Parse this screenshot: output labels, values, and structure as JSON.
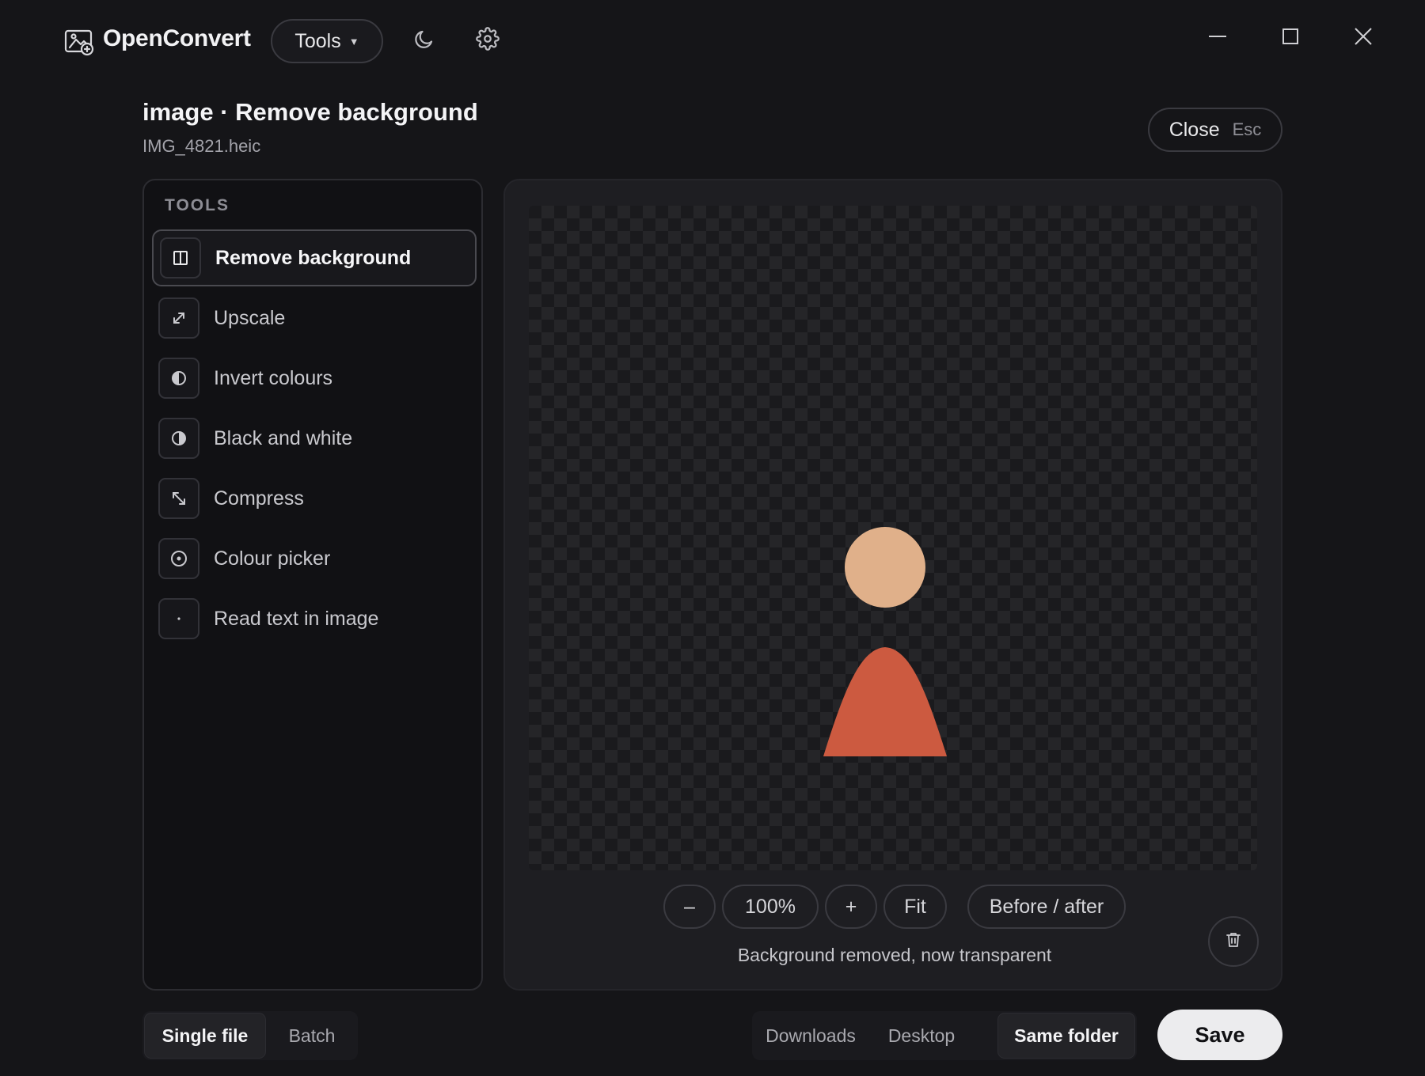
{
  "app": {
    "title": "OpenConvert",
    "logo_icon": "image-converter-logo-icon"
  },
  "header": {
    "tools_dropdown_label": "Tools",
    "theme_icon": "moon-icon",
    "settings_icon": "gear-icon",
    "window_controls": [
      "minimize-icon",
      "maximize-icon",
      "close-icon"
    ]
  },
  "page": {
    "title": "image · Remove background",
    "file_name": "IMG_4821.heic",
    "close_label": "Close",
    "close_shortcut": "Esc"
  },
  "tools_panel": {
    "heading": "TOOLS",
    "items": [
      {
        "label": "Remove background",
        "icon": "split-square-icon",
        "active": true
      },
      {
        "label": "Upscale",
        "icon": "expand-arrows-icon",
        "active": false
      },
      {
        "label": "Invert colours",
        "icon": "half-circle-icon",
        "active": false
      },
      {
        "label": "Black and white",
        "icon": "contrast-icon",
        "active": false
      },
      {
        "label": "Compress",
        "icon": "compress-arrows-icon",
        "active": false
      },
      {
        "label": "Colour picker",
        "icon": "target-icon",
        "active": false
      },
      {
        "label": "Read text in image",
        "icon": "dot-icon",
        "active": false
      }
    ]
  },
  "preview": {
    "subject_colors": {
      "head": "#e0b08a",
      "body": "#cc5a40"
    },
    "zoom_out_label": "–",
    "zoom_level": "100%",
    "zoom_in_label": "+",
    "fit_label": "Fit",
    "before_after_label": "Before / after",
    "status": "Background removed, now transparent",
    "delete_icon": "trash-icon"
  },
  "footer": {
    "mode_options": [
      {
        "label": "Single file",
        "selected": true
      },
      {
        "label": "Batch",
        "selected": false
      }
    ],
    "destination_options": [
      {
        "label": "Downloads",
        "selected": false
      },
      {
        "label": "Desktop",
        "selected": false
      },
      {
        "label": "Same folder",
        "selected": true
      }
    ],
    "save_label": "Save"
  }
}
